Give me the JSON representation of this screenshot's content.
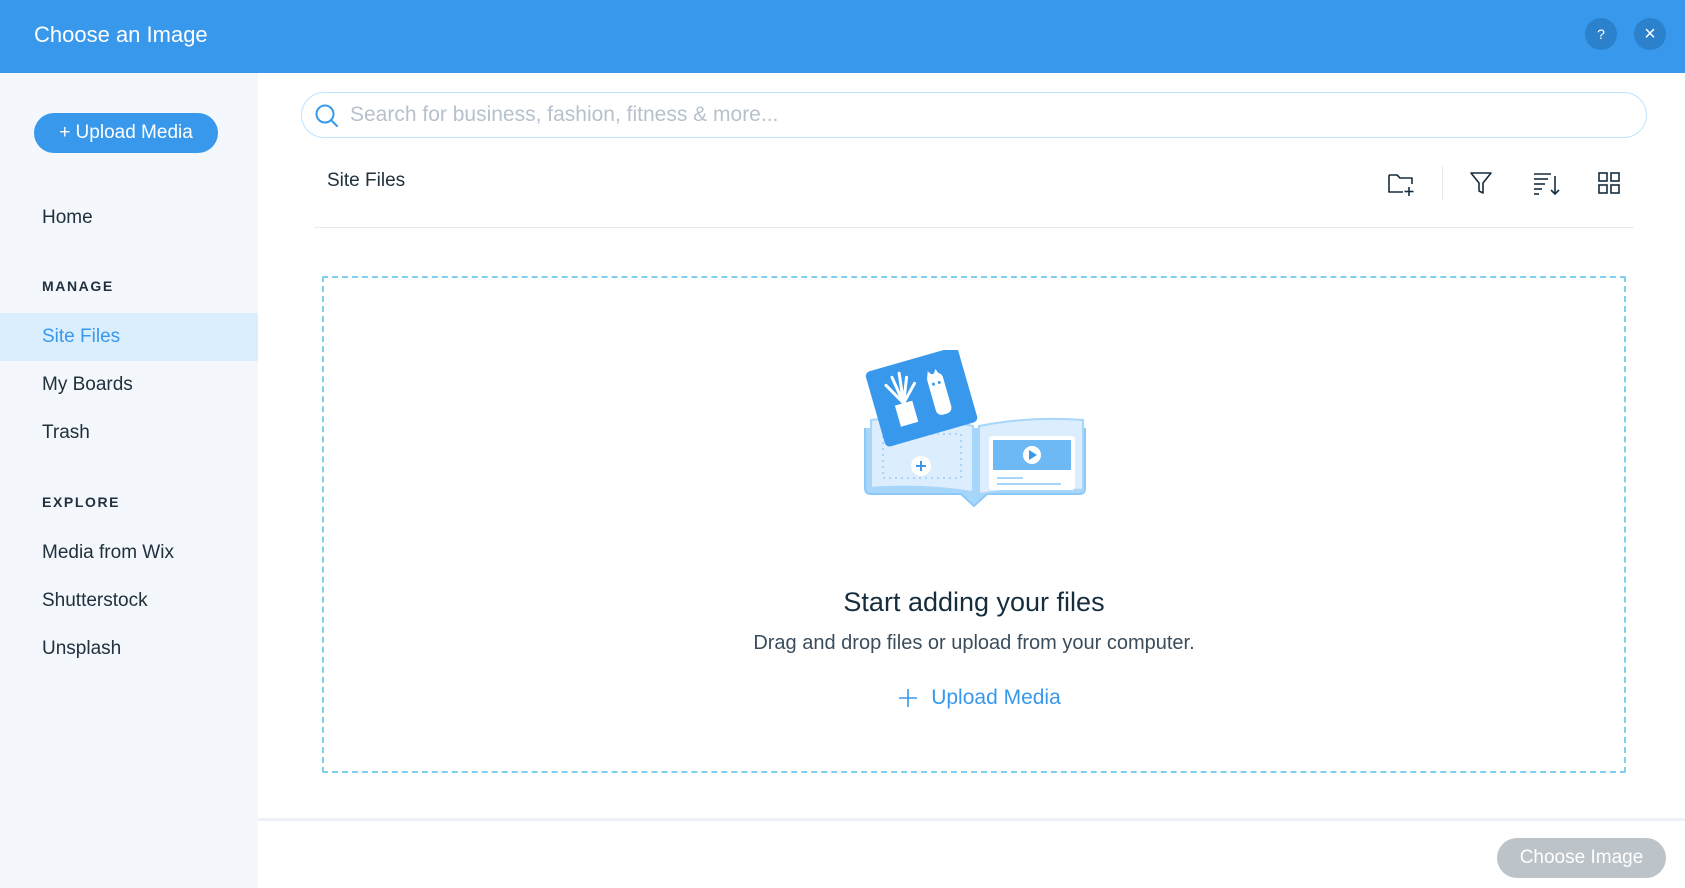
{
  "header": {
    "title": "Choose an Image",
    "help_label": "?",
    "close_label": "×"
  },
  "sidebar": {
    "upload_label": "+ Upload Media",
    "home": "Home",
    "manage_label": "MANAGE",
    "manage_items": [
      "Site Files",
      "My Boards",
      "Trash"
    ],
    "explore_label": "EXPLORE",
    "explore_items": [
      "Media from Wix",
      "Shutterstock",
      "Unsplash"
    ],
    "active_item": "Site Files"
  },
  "search": {
    "placeholder": "Search for business, fashion, fitness & more...",
    "value": ""
  },
  "toolbar": {
    "folder_title": "Site Files",
    "icons": [
      "new-folder-icon",
      "filter-icon",
      "sort-icon",
      "grid-view-icon"
    ]
  },
  "dropzone": {
    "title": "Start adding your files",
    "subtitle": "Drag and drop files or upload from your computer.",
    "upload_label": "Upload Media"
  },
  "footer": {
    "choose_label": "Choose Image"
  },
  "colors": {
    "accent": "#3899ec",
    "sidebar_bg": "#f4f8fd",
    "active_bg": "#daeefe",
    "dashed_border": "#7fd0f0",
    "disabled_button": "#bcc3c9"
  }
}
